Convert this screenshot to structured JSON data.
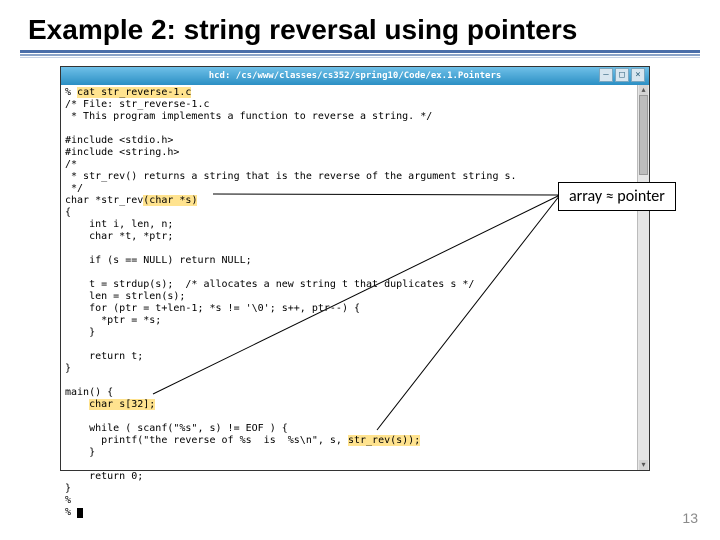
{
  "title": "Example 2: string reversal using pointers",
  "terminal": {
    "titlebar": "hcd: /cs/www/classes/cs352/spring10/Code/ex.1.Pointers",
    "btn_min": "–",
    "btn_max": "□",
    "btn_close": "×"
  },
  "code": {
    "l1a": "% ",
    "l1b": "cat str_reverse-1.c",
    "l2": "/* File: str_reverse-1.c",
    "l3": " * This program implements a function to reverse a string. */",
    "blank": "",
    "l4": "#include <stdio.h>",
    "l5": "#include <string.h>",
    "l6": "/*",
    "l7": " * str_rev() returns a string that is the reverse of the argument string s.",
    "l8": " */",
    "l9a": "char *str_rev",
    "l9b": "(char *s)",
    "l10": "{",
    "l11": "    int i, len, n;",
    "l12": "    char *t, *ptr;",
    "l13": "    if (s == NULL) return NULL;",
    "l14": "    t = strdup(s);  /* allocates a new string t that duplicates s */",
    "l15": "    len = strlen(s);",
    "l16": "    for (ptr = t+len-1; *s != '\\0'; s++, ptr--) {",
    "l17": "      *ptr = *s;",
    "l18": "    }",
    "l19": "    return t;",
    "l20": "}",
    "l21": "main() {",
    "l22a": "    ",
    "l22b": "char s[32];",
    "l23": "    while ( scanf(\"%s\", s) != EOF ) {",
    "l24a": "      printf(\"the reverse of %s  is  %s\\n\", s, ",
    "l24b": "str_rev(s));",
    "l25": "    }",
    "l26": "    return 0;",
    "l27": "}",
    "l28": "% ",
    "l29": "% "
  },
  "callout": {
    "text": "array ≈ pointer"
  },
  "page": "13"
}
